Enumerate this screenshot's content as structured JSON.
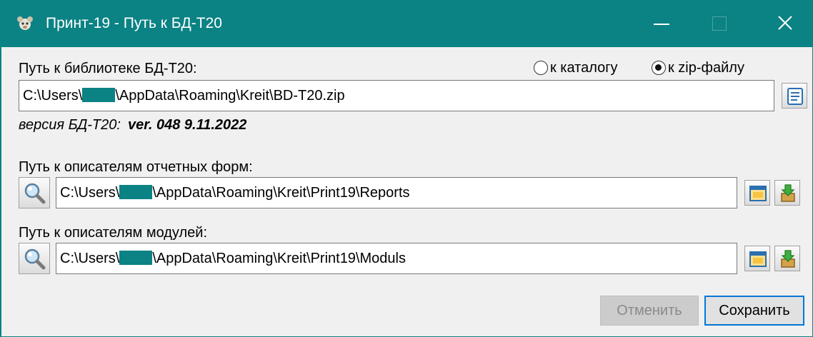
{
  "window": {
    "title": "Принт-19 - Путь к БД-Т20",
    "icon": "app-icon",
    "controls": {
      "minimize": "minimize-icon",
      "maximize": "maximize-icon",
      "close": "close-icon"
    },
    "accent_color": "#0b8284"
  },
  "library": {
    "label": "Путь к библиотеке БД-Т20:",
    "radio_catalog": {
      "label": "к каталогу",
      "checked": false
    },
    "radio_zip": {
      "label": "к zip-файлу",
      "checked": true
    },
    "path_prefix": "C:\\Users\\",
    "path_suffix": "\\AppData\\Roaming\\Kreit\\BD-T20.zip",
    "browse_icon": "file-browse-icon"
  },
  "version": {
    "label": "версия БД-Т20:",
    "value": "ver. 048 9.11.2022"
  },
  "reports": {
    "label": "Путь к описателям отчетных форм:",
    "path_prefix": "C:\\Users\\",
    "path_suffix": "\\AppData\\Roaming\\Kreit\\Print19\\Reports",
    "search_icon": "magnifier-icon",
    "folder_icon": "folder-icon",
    "download_icon": "download-icon"
  },
  "modules": {
    "label": "Путь к описателям модулей:",
    "path_prefix": "C:\\Users\\",
    "path_suffix": "\\AppData\\Roaming\\Kreit\\Print19\\Moduls",
    "search_icon": "magnifier-icon",
    "folder_icon": "folder-icon",
    "download_icon": "download-icon"
  },
  "buttons": {
    "cancel": {
      "label": "Отменить",
      "enabled": false
    },
    "save": {
      "label": "Сохранить",
      "enabled": true
    }
  }
}
